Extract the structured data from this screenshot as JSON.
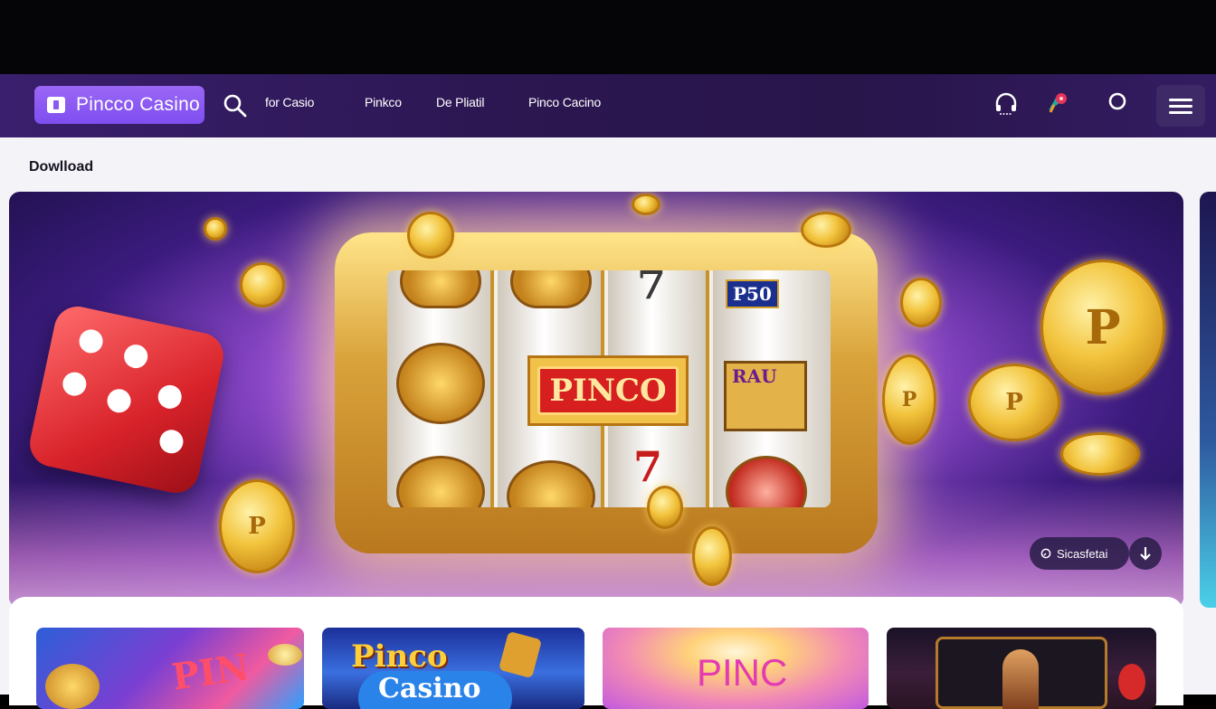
{
  "nav": {
    "brand": "Pincco Casino",
    "links": [
      "for Casio",
      "Pinkco",
      "De Pliatil",
      "Pinco Cacino"
    ]
  },
  "section_title": "Dowlload",
  "hero": {
    "slot_labels": {
      "center_badge": "PINCO",
      "top_right": "P50",
      "middle_right": "RAU",
      "top_seven": "7",
      "bottom_seven": "7"
    },
    "coin_letter": "P",
    "pill_text": "Sicasfetai"
  },
  "game_cards": [
    {
      "text": "PIN"
    },
    {
      "text_top": "Pinco",
      "text_bottom": "Casino"
    },
    {
      "text": "PINC"
    },
    {
      "text": ""
    }
  ],
  "colors": {
    "accent": "#8a5af2",
    "nav_bg": "#2c1752"
  }
}
